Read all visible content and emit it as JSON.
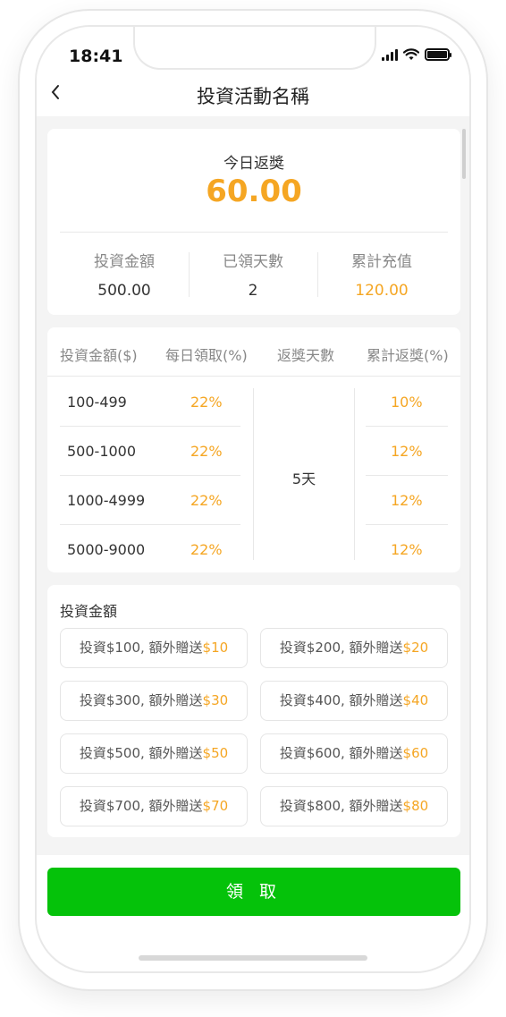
{
  "status": {
    "time": "18:41"
  },
  "nav": {
    "title": "投資活動名稱",
    "back_icon": "chevron-left-icon"
  },
  "summary": {
    "label": "今日返獎",
    "amount": "60.00",
    "stats": [
      {
        "label": "投資金額",
        "value": "500.00"
      },
      {
        "label": "已領天數",
        "value": "2"
      },
      {
        "label": "累計充值",
        "value": "120.00"
      }
    ]
  },
  "table": {
    "headers": [
      "投資金額($)",
      "每日領取(%)",
      "返獎天數",
      "累計返獎(%)"
    ],
    "days": "5天",
    "rows": [
      {
        "range": "100-499",
        "daily": "22%",
        "accum": "10%"
      },
      {
        "range": "500-1000",
        "daily": "22%",
        "accum": "12%"
      },
      {
        "range": "1000-4999",
        "daily": "22%",
        "accum": "12%"
      },
      {
        "range": "5000-9000",
        "daily": "22%",
        "accum": "12%"
      }
    ]
  },
  "options": {
    "title": "投資金額",
    "items": [
      {
        "text": "投資$100,  額外贈送",
        "bonus": "$10"
      },
      {
        "text": "投資$200,  額外贈送",
        "bonus": "$20"
      },
      {
        "text": "投資$300,  額外贈送",
        "bonus": "$30"
      },
      {
        "text": "投資$400,  額外贈送",
        "bonus": "$40"
      },
      {
        "text": "投資$500,  額外贈送",
        "bonus": "$50"
      },
      {
        "text": "投資$600,  額外贈送",
        "bonus": "$60"
      },
      {
        "text": "投資$700,  額外贈送",
        "bonus": "$70"
      },
      {
        "text": "投資$800,  額外贈送",
        "bonus": "$80"
      }
    ]
  },
  "action": {
    "button_label": "領 取"
  },
  "colors": {
    "accent": "#f5a623",
    "primary": "#05c20a"
  }
}
